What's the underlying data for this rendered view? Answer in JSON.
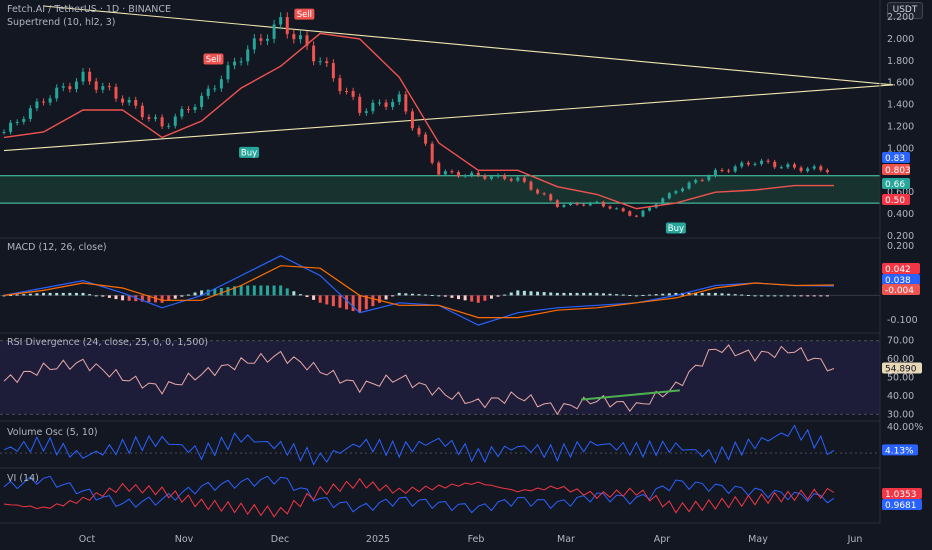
{
  "header": {
    "symbol_title": "Fetch.AI / TetherUS · 1D · BINANCE",
    "indicator_label": "Supertrend (10, hl2, 3)",
    "currency": "USDT"
  },
  "colors": {
    "background": "#131722",
    "up": "#26a69a",
    "down": "#ef5350",
    "trend_line": "#f0e6b0",
    "zone": "#1d4a3a",
    "zone_border": "#4ed8b0",
    "macd_line": "#2962ff",
    "signal_line": "#ff6d00",
    "rsi_line": "#e8a8a8",
    "vol_osc_line": "#2962ff",
    "vi_plus": "#2962ff",
    "vi_minus": "#f23645"
  },
  "x_axis": {
    "labels": [
      "Oct",
      "Nov",
      "Dec",
      "2025",
      "Feb",
      "Mar",
      "Apr",
      "May",
      "Jun"
    ]
  },
  "chart_data": [
    {
      "type": "candlestick",
      "panel": "price",
      "ylim": [
        0.2,
        2.3
      ],
      "y_ticks": [
        "2.200",
        "2.000",
        "1.800",
        "1.600",
        "1.400",
        "1.200",
        "1.000",
        "0.600",
        "0.400",
        "0.200"
      ],
      "dates": [
        "2024-09-10",
        "2024-09-25",
        "2024-10-10",
        "2024-10-25",
        "2024-11-10",
        "2024-11-20",
        "2024-11-30",
        "2024-12-06",
        "2024-12-18",
        "2024-12-31",
        "2025-01-15",
        "2025-01-31",
        "2025-02-15",
        "2025-02-28",
        "2025-03-10",
        "2025-03-25",
        "2025-04-07",
        "2025-04-20",
        "2025-05-01",
        "2025-05-10",
        "2025-05-20",
        "2025-05-26"
      ],
      "close": [
        1.15,
        1.45,
        1.65,
        1.45,
        1.2,
        1.45,
        1.85,
        2.15,
        1.8,
        1.35,
        1.45,
        0.78,
        0.75,
        0.72,
        0.48,
        0.5,
        0.38,
        0.62,
        0.78,
        0.88,
        0.82,
        0.803
      ],
      "supertrend": [
        1.1,
        1.15,
        1.35,
        1.35,
        1.1,
        1.25,
        1.55,
        1.75,
        2.05,
        2.0,
        1.65,
        1.05,
        0.8,
        0.8,
        0.65,
        0.58,
        0.45,
        0.5,
        0.6,
        0.62,
        0.66,
        0.66
      ],
      "zone": [
        0.5,
        0.75
      ],
      "trend_line_upper": [
        [
          1.0,
          2.3
        ],
        [
          22.5,
          1.58
        ]
      ],
      "trend_line_lower": [
        [
          0.0,
          0.98
        ],
        [
          22.5,
          1.58
        ]
      ],
      "signals": [
        {
          "label": "Sell",
          "date": "2024-10-28",
          "price": 1.72
        },
        {
          "label": "Buy",
          "date": "2024-11-12",
          "price": 1.05
        },
        {
          "label": "Sell",
          "date": "2024-12-08",
          "price": 2.13
        },
        {
          "label": "Buy",
          "date": "2025-04-12",
          "price": 0.36
        }
      ],
      "price_tags": [
        {
          "value": "0.83",
          "color": "#2962ff"
        },
        {
          "value": "0.803",
          "color": "#ef5350"
        },
        {
          "value": "0.66",
          "color": "#26a69a"
        },
        {
          "value": "0.50",
          "color": "#f23645"
        }
      ]
    },
    {
      "type": "histogram+line",
      "panel": "macd",
      "title": "MACD (12, 26, close)",
      "ylim": [
        -0.14,
        0.22
      ],
      "y_ticks": [
        "0.200",
        "-0.100"
      ],
      "macd": [
        0.0,
        0.03,
        0.06,
        0.01,
        -0.05,
        0.0,
        0.08,
        0.16,
        0.08,
        -0.07,
        -0.03,
        -0.04,
        -0.12,
        -0.07,
        -0.05,
        -0.04,
        -0.03,
        0.0,
        0.04,
        0.05,
        0.04,
        0.038
      ],
      "signal": [
        0.0,
        0.02,
        0.05,
        0.03,
        -0.02,
        -0.02,
        0.04,
        0.12,
        0.11,
        0.0,
        -0.04,
        -0.04,
        -0.09,
        -0.09,
        -0.06,
        -0.05,
        -0.03,
        -0.01,
        0.03,
        0.05,
        0.04,
        0.042
      ],
      "histogram": [
        0.0,
        0.01,
        0.01,
        -0.02,
        -0.03,
        0.02,
        0.04,
        0.04,
        -0.03,
        -0.07,
        0.01,
        0.0,
        -0.03,
        0.02,
        0.01,
        0.01,
        0.0,
        0.01,
        0.01,
        0.0,
        0.0,
        -0.004
      ],
      "value_tags": [
        {
          "value": "0.042",
          "color": "#f23645"
        },
        {
          "value": "0.038",
          "color": "#2962ff"
        },
        {
          "value": "-0.004",
          "color": "#ef5350"
        }
      ]
    },
    {
      "type": "line",
      "panel": "rsi",
      "title": "RSI Divergence (24, close, 25, 0, 0, 1,500)",
      "ylim": [
        28,
        72
      ],
      "y_ticks": [
        "70.00",
        "60.00",
        "50.00",
        "40.00",
        "30.00"
      ],
      "values": [
        48,
        55,
        58,
        50,
        44,
        52,
        58,
        62,
        54,
        45,
        50,
        42,
        36,
        40,
        33,
        38,
        34,
        45,
        66,
        62,
        65,
        54.89
      ],
      "divergence_line": [
        [
          14.6,
          38
        ],
        [
          17.1,
          43
        ]
      ],
      "value_tags": [
        {
          "value": "54.890",
          "color": "#e8a8a8"
        }
      ]
    },
    {
      "type": "line",
      "panel": "volume_osc",
      "title": "Volume Osc (5, 10)",
      "ylim": [
        -20,
        45
      ],
      "y_ticks": [
        "40.00%"
      ],
      "values": [
        5,
        15,
        -5,
        10,
        20,
        0,
        25,
        10,
        -10,
        15,
        5,
        20,
        -5,
        10,
        0,
        15,
        5,
        10,
        -5,
        15,
        35,
        4.13
      ],
      "value_tags": [
        {
          "value": "4.13%",
          "color": "#2962ff"
        }
      ]
    },
    {
      "type": "line",
      "panel": "vi",
      "title": "VI (14)",
      "ylim": [
        0.7,
        1.3
      ],
      "series": [
        {
          "name": "VI +",
          "values": [
            1.1,
            1.2,
            1.05,
            0.9,
            0.95,
            1.1,
            1.15,
            1.2,
            0.95,
            0.85,
            0.95,
            0.9,
            0.85,
            0.95,
            0.9,
            1.0,
            0.95,
            1.15,
            1.1,
            1.05,
            1.0,
            0.9681
          ]
        },
        {
          "name": "VI -",
          "values": [
            0.9,
            0.85,
            0.95,
            1.1,
            1.05,
            0.9,
            0.85,
            0.8,
            1.05,
            1.15,
            1.05,
            1.1,
            1.15,
            1.05,
            1.1,
            1.0,
            1.05,
            0.85,
            0.9,
            0.95,
            1.0,
            1.0353
          ]
        }
      ],
      "value_tags": [
        {
          "value": "1.0353",
          "color": "#f23645"
        },
        {
          "value": "0.9681",
          "color": "#2962ff"
        }
      ]
    }
  ]
}
